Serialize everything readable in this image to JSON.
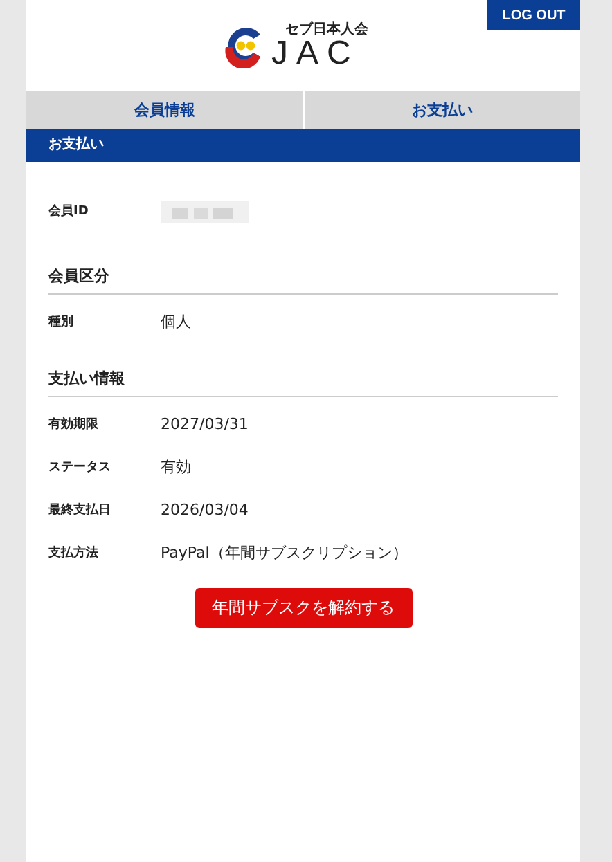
{
  "header": {
    "logo_caption": "セブ日本人会",
    "logo_text": "JAC",
    "logout": "LOG OUT"
  },
  "tabs": [
    {
      "label": "会員情報",
      "selected": false
    },
    {
      "label": "お支払い",
      "selected": false
    }
  ],
  "banner": "お支払い",
  "member_id": {
    "label": "会員ID"
  },
  "sections": [
    {
      "title": "会員区分",
      "rows": [
        {
          "label": "種別",
          "value": "個人"
        }
      ]
    },
    {
      "title": "支払い情報",
      "rows": [
        {
          "label": "有効期限",
          "value": "2027/03/31"
        },
        {
          "label": "ステータス",
          "value": "有効"
        },
        {
          "label": "最終支払日",
          "value": "2026/03/04"
        },
        {
          "label": "支払方法",
          "value": "PayPal（年間サブスクリプション）"
        }
      ]
    }
  ],
  "cancel_button": "年間サブスクを解約する"
}
